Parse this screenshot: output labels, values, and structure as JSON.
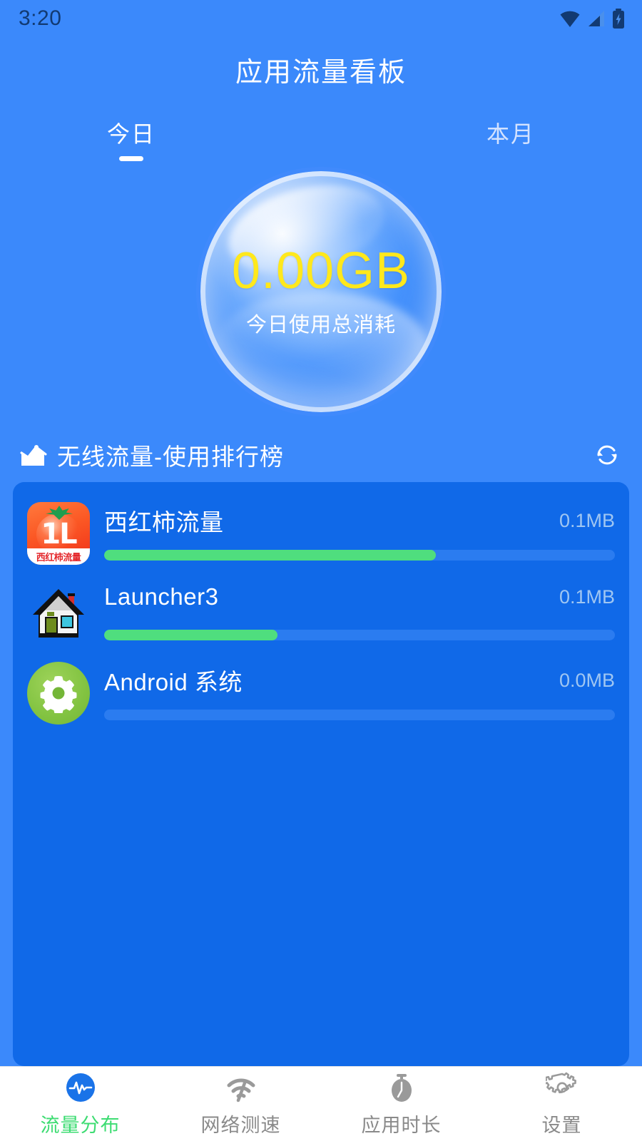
{
  "status_bar": {
    "time": "3:20",
    "icons": [
      "wifi-icon",
      "cellular-signal-icon",
      "battery-charging-icon"
    ]
  },
  "header": {
    "title": "应用流量看板"
  },
  "period_tabs": {
    "items": [
      {
        "label": "今日",
        "active": true
      },
      {
        "label": "本月",
        "active": false
      }
    ]
  },
  "bubble": {
    "value": "0.00GB",
    "label": "今日使用总消耗",
    "value_color": "#ffe81c",
    "label_color": "#ffffff"
  },
  "ranking": {
    "icon": "chart-up-icon",
    "title": "无线流量-使用排行榜",
    "refresh_icon": "refresh-icon",
    "rows": [
      {
        "icon": "tomato-app-icon",
        "icon_banner_text": "西红柿流量",
        "icon_glyph": "1L",
        "name": "西红柿流量",
        "usage": "0.1MB",
        "progress_percent": 65
      },
      {
        "icon": "house-pixel-icon",
        "name": "Launcher3",
        "usage": "0.1MB",
        "progress_percent": 34
      },
      {
        "icon": "green-gear-icon",
        "name": "Android 系统",
        "usage": "0.0MB",
        "progress_percent": 0
      }
    ]
  },
  "bottom_nav": {
    "items": [
      {
        "label": "流量分布",
        "icon": "waveform-circle-icon",
        "active": true
      },
      {
        "label": "网络测速",
        "icon": "speedometer-wifi-icon",
        "active": false
      },
      {
        "label": "应用时长",
        "icon": "stopwatch-icon",
        "active": false
      },
      {
        "label": "设置",
        "icon": "gear-outline-icon",
        "active": false
      }
    ]
  },
  "colors": {
    "page_bg": "#3b89fb",
    "card_bg": "#1069e8",
    "progress_fill": "#4fde7e",
    "progress_track": "#2b7cf0",
    "accent_active": "#3ddc72",
    "usage_text": "#9fc6f2"
  }
}
